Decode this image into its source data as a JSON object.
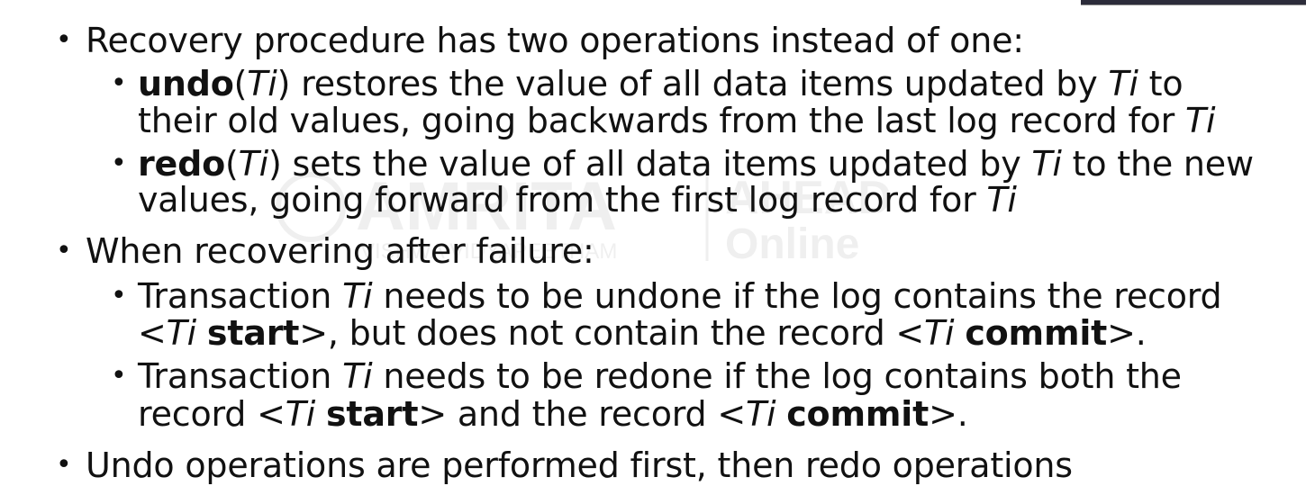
{
  "bullet_char": "•",
  "watermark": {
    "brand": "AMRITA",
    "sub": "VISHWA VIDYAPEETHAM",
    "right_top": "AHEAD",
    "right_bottom": "Online"
  },
  "items": [
    {
      "text": "Recovery procedure has two operations instead of one:",
      "subitems": [
        {
          "line1": {
            "b1": "undo",
            "t1": "(",
            "i1": "Ti",
            "t2": ") restores the value of all data items updated by ",
            "i2": "Ti",
            "t3": " to"
          },
          "line2": {
            "t1": "their old values, going backwards from the last log record for ",
            "i1": "Ti"
          }
        },
        {
          "line1": {
            "b1": "redo",
            "t1": "(",
            "i1": "Ti",
            "t2": ") sets the value of all data items updated by ",
            "i2": "Ti",
            "t3": " to the new"
          },
          "line2": {
            "t1": "values, going forward from the first log record for ",
            "i1": "Ti"
          }
        }
      ]
    },
    {
      "text": "When recovering after failure:",
      "subitems": [
        {
          "line1": {
            "t1": "Transaction ",
            "i1": "Ti",
            "t2": " needs to be undone if the log contains the record"
          },
          "line2": {
            "t1": "<",
            "i1": "Ti",
            "t2": " ",
            "b1": "start",
            "t3": ">, but does not contain the record <",
            "i2": "Ti",
            "t4": " ",
            "b2": "commit",
            "t5": ">."
          }
        },
        {
          "line1": {
            "t1": "Transaction ",
            "i1": "Ti",
            "t2": " needs to be redone if the log contains both the"
          },
          "line2": {
            "t1": "record <",
            "i1": "Ti",
            "t2": " ",
            "b1": "start",
            "t3": "> and the record <",
            "i2": "Ti",
            "t4": " ",
            "b2": "commit",
            "t5": ">."
          }
        }
      ]
    },
    {
      "text": "Undo operations are performed first, then redo operations",
      "subitems": []
    }
  ]
}
